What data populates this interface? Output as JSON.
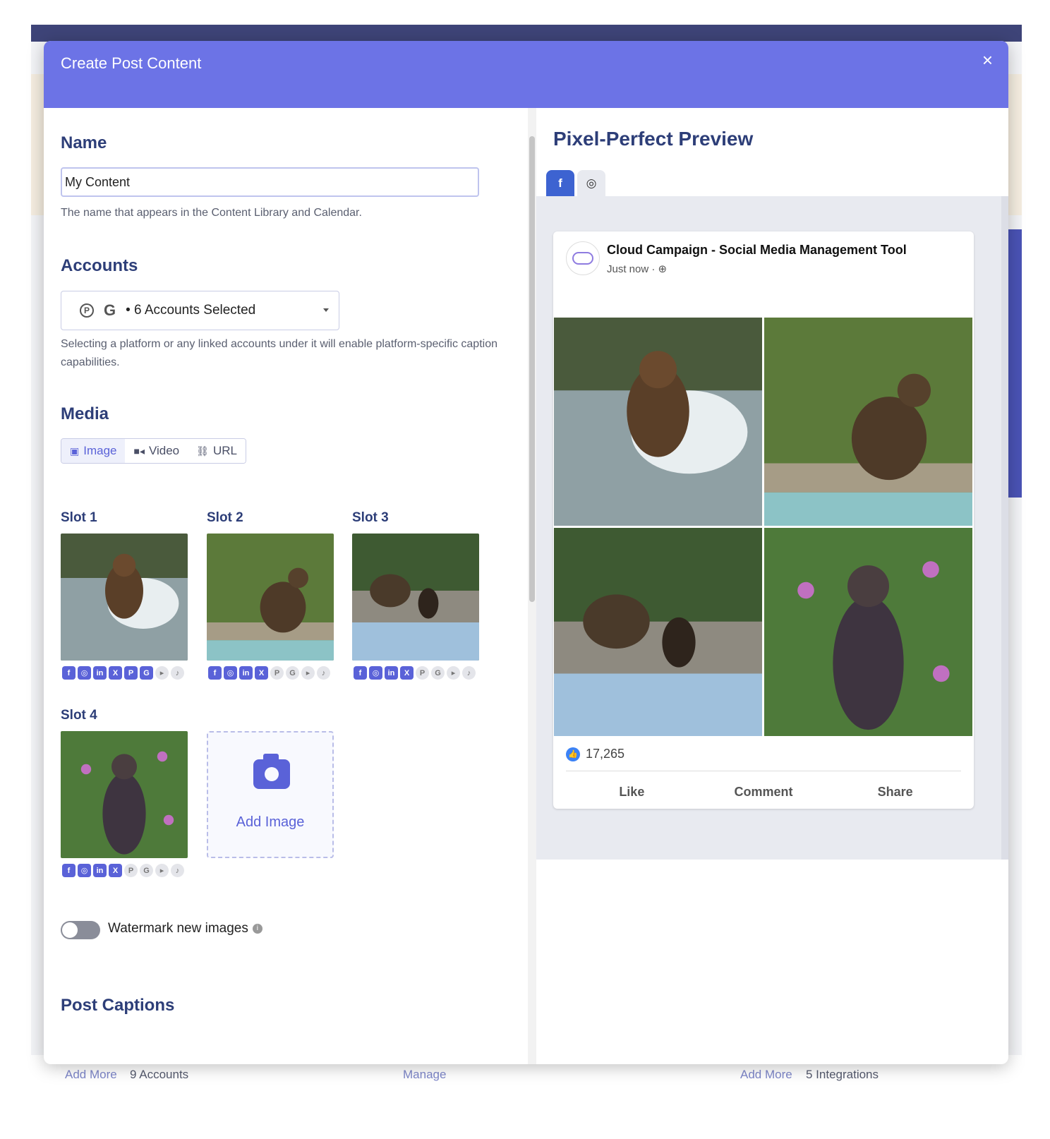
{
  "background": {
    "footer_left_link": "Add More",
    "footer_left_count": "9 Accounts",
    "footer_mid_link": "Manage",
    "footer_right_link": "Add More",
    "footer_right_count": "5 Integrations"
  },
  "modal": {
    "title": "Create Post Content",
    "close_glyph": "×"
  },
  "name_section": {
    "title": "Name",
    "value": "My Content",
    "help": "The name that appears in the Content Library and Calendar."
  },
  "accounts_section": {
    "title": "Accounts",
    "selected_label": "• 6 Accounts Selected",
    "help": "Selecting a platform or any linked accounts under it will enable platform-specific caption capabilities."
  },
  "media_section": {
    "title": "Media",
    "tabs": [
      {
        "label": "Image",
        "icon": "camera-icon"
      },
      {
        "label": "Video",
        "icon": "video-icon"
      },
      {
        "label": "URL",
        "icon": "link-icon"
      }
    ],
    "active_tab": "Image",
    "slots": [
      {
        "label": "Slot 1",
        "image": "bear-splashing-in-river"
      },
      {
        "label": "Slot 2",
        "image": "bear-walking-by-grass"
      },
      {
        "label": "Slot 3",
        "image": "bear-and-cub-on-riverbank"
      },
      {
        "label": "Slot 4",
        "image": "bear-standing-in-flowers"
      }
    ],
    "add_image_label": "Add Image",
    "watermark_label": "Watermark new images",
    "watermark_on": false
  },
  "captions_section": {
    "title": "Post Captions"
  },
  "preview": {
    "title": "Pixel-Perfect Preview",
    "tabs": [
      {
        "icon": "facebook-icon",
        "glyph": "f",
        "active": true
      },
      {
        "icon": "instagram-icon",
        "glyph": "◎",
        "active": false
      }
    ],
    "post": {
      "page_name": "Cloud Campaign - Social Media Management Tool",
      "time": "Just now ·",
      "likes": "17,265",
      "actions": [
        "Like",
        "Comment",
        "Share"
      ]
    }
  }
}
